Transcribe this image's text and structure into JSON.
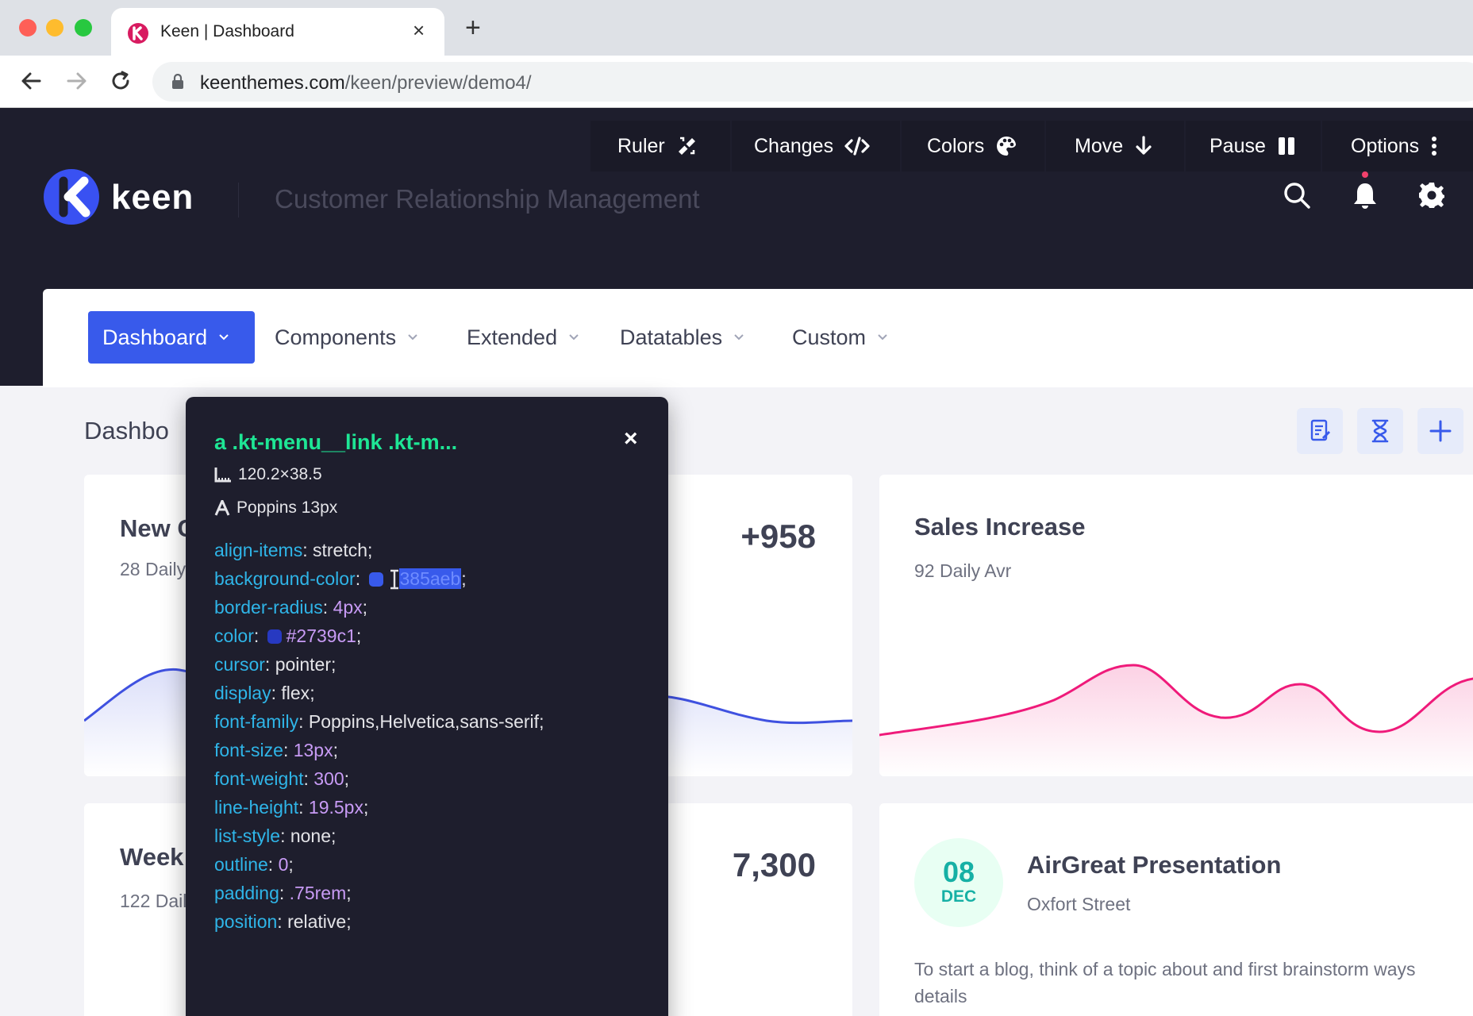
{
  "browser": {
    "tab_title": "Keen | Dashboard",
    "tab_close": "×",
    "new_tab": "+",
    "url_host": "keenthemes.com",
    "url_path": "/keen/preview/demo4/"
  },
  "devbar": {
    "items": [
      {
        "label": "Ruler",
        "icon": "ruler-icon"
      },
      {
        "label": "Changes",
        "icon": "code-icon"
      },
      {
        "label": "Colors",
        "icon": "palette-icon"
      },
      {
        "label": "Move",
        "icon": "arrow-down-icon"
      },
      {
        "label": "Pause",
        "icon": "pause-icon"
      },
      {
        "label": "Options",
        "icon": "vertical-dots-icon"
      }
    ]
  },
  "header": {
    "brand": "keen",
    "subtitle": "Customer Relationship Management",
    "colors": {
      "dark": "#1e1e2d",
      "notification_dot": "#f1416c"
    }
  },
  "menu": {
    "items": [
      "Dashboard",
      "Components",
      "Extended",
      "Datatables",
      "Custom"
    ],
    "active_color": "#385aeb"
  },
  "toolbar": {
    "title": "Dashbo"
  },
  "cards": {
    "a": {
      "title": "New C",
      "sub": "28 Daily",
      "value": "+958",
      "color": "#3f51e0"
    },
    "b": {
      "title": "Sales Increase",
      "sub": "92 Daily Avr",
      "color": "#ef1a7a"
    },
    "c": {
      "title": "Week",
      "sub": "122 Daily",
      "value": "7,300"
    },
    "d": {
      "date_day": "08",
      "date_month": "DEC",
      "title": "AirGreat Presentation",
      "sub": "Oxfort Street",
      "body_line1": "To start a blog, think of a topic about and first brainstorm ways",
      "body_line2": "details"
    }
  },
  "inspector": {
    "selector": "a .kt-menu__link .kt-m...",
    "close": "×",
    "size": "120.2×38.5",
    "font": "Poppins 13px",
    "props": {
      "align_items": {
        "k": "align-items",
        "v": "stretch"
      },
      "background_color": {
        "k": "background-color",
        "v_pre": "#",
        "v_hl": "385aeb",
        "swatch": "#385aeb"
      },
      "border_radius": {
        "k": "border-radius",
        "v": "4px"
      },
      "color": {
        "k": "color",
        "v": "#2739c1",
        "swatch": "#2739c1"
      },
      "cursor": {
        "k": "cursor",
        "v": "pointer"
      },
      "display": {
        "k": "display",
        "v": "flex"
      },
      "font_family": {
        "k": "font-family",
        "v": "Poppins,Helvetica,sans-serif"
      },
      "font_size": {
        "k": "font-size",
        "v": "13px"
      },
      "font_weight": {
        "k": "font-weight",
        "v": "300"
      },
      "line_height": {
        "k": "line-height",
        "v": "19.5px"
      },
      "list_style": {
        "k": "list-style",
        "v": "none"
      },
      "outline": {
        "k": "outline",
        "v": "0"
      },
      "padding": {
        "k": "padding",
        "v": ".75rem"
      },
      "position": {
        "k": "position",
        "v": "relative"
      }
    }
  }
}
